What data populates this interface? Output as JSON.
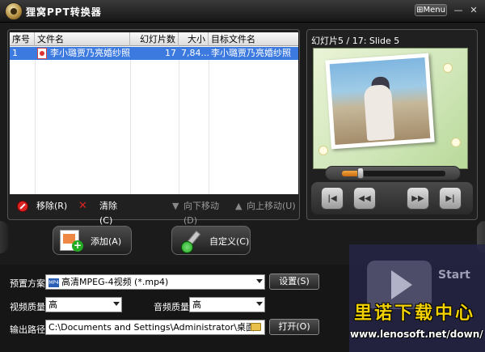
{
  "window": {
    "title": "狸窝PPT转换器",
    "menu_label": "Menu",
    "minimize": "—",
    "close": "✕"
  },
  "table": {
    "headers": [
      "序号",
      "文件名",
      "幻灯片数",
      "大小",
      "目标文件名"
    ],
    "rows": [
      {
        "index": "1",
        "filename": "李小璐贾乃亮婚纱照",
        "slides": "17",
        "size": "7,84...",
        "target": "李小璐贾乃亮婚纱照"
      }
    ]
  },
  "list_actions": {
    "remove": "移除(R)",
    "clear": "清除(C)",
    "move_down": "向下移动(D)",
    "move_up": "向上移动(U)"
  },
  "preview": {
    "label": "幻灯片5 / 17: Slide 5",
    "seek_progress": 0.18,
    "controls": [
      "|◀",
      "◀◀",
      "▶▶",
      "▶|"
    ]
  },
  "buttons": {
    "add": "添加(A)",
    "custom": "自定义(C)"
  },
  "settings": {
    "preset_label": "预置方案:",
    "preset_value": "高清MPEG-4视频 (*.mp4)",
    "preset_icon_text": "MP4",
    "settings_button": "设置(S)",
    "video_quality_label": "视频质量:",
    "video_quality_value": "高",
    "audio_quality_label": "音频质量:",
    "audio_quality_value": "高",
    "output_label": "输出路径:",
    "output_value": "C:\\Documents and Settings\\Administrator\\桌面",
    "open_button": "打开(O)"
  },
  "watermark": {
    "title": "里诺下载中心",
    "url": "www.lenosoft.net/down/",
    "start": "Start"
  },
  "colors": {
    "selection": "#3c7ae0",
    "accent": "#f4a840",
    "watermark_text": "#f0d000"
  }
}
